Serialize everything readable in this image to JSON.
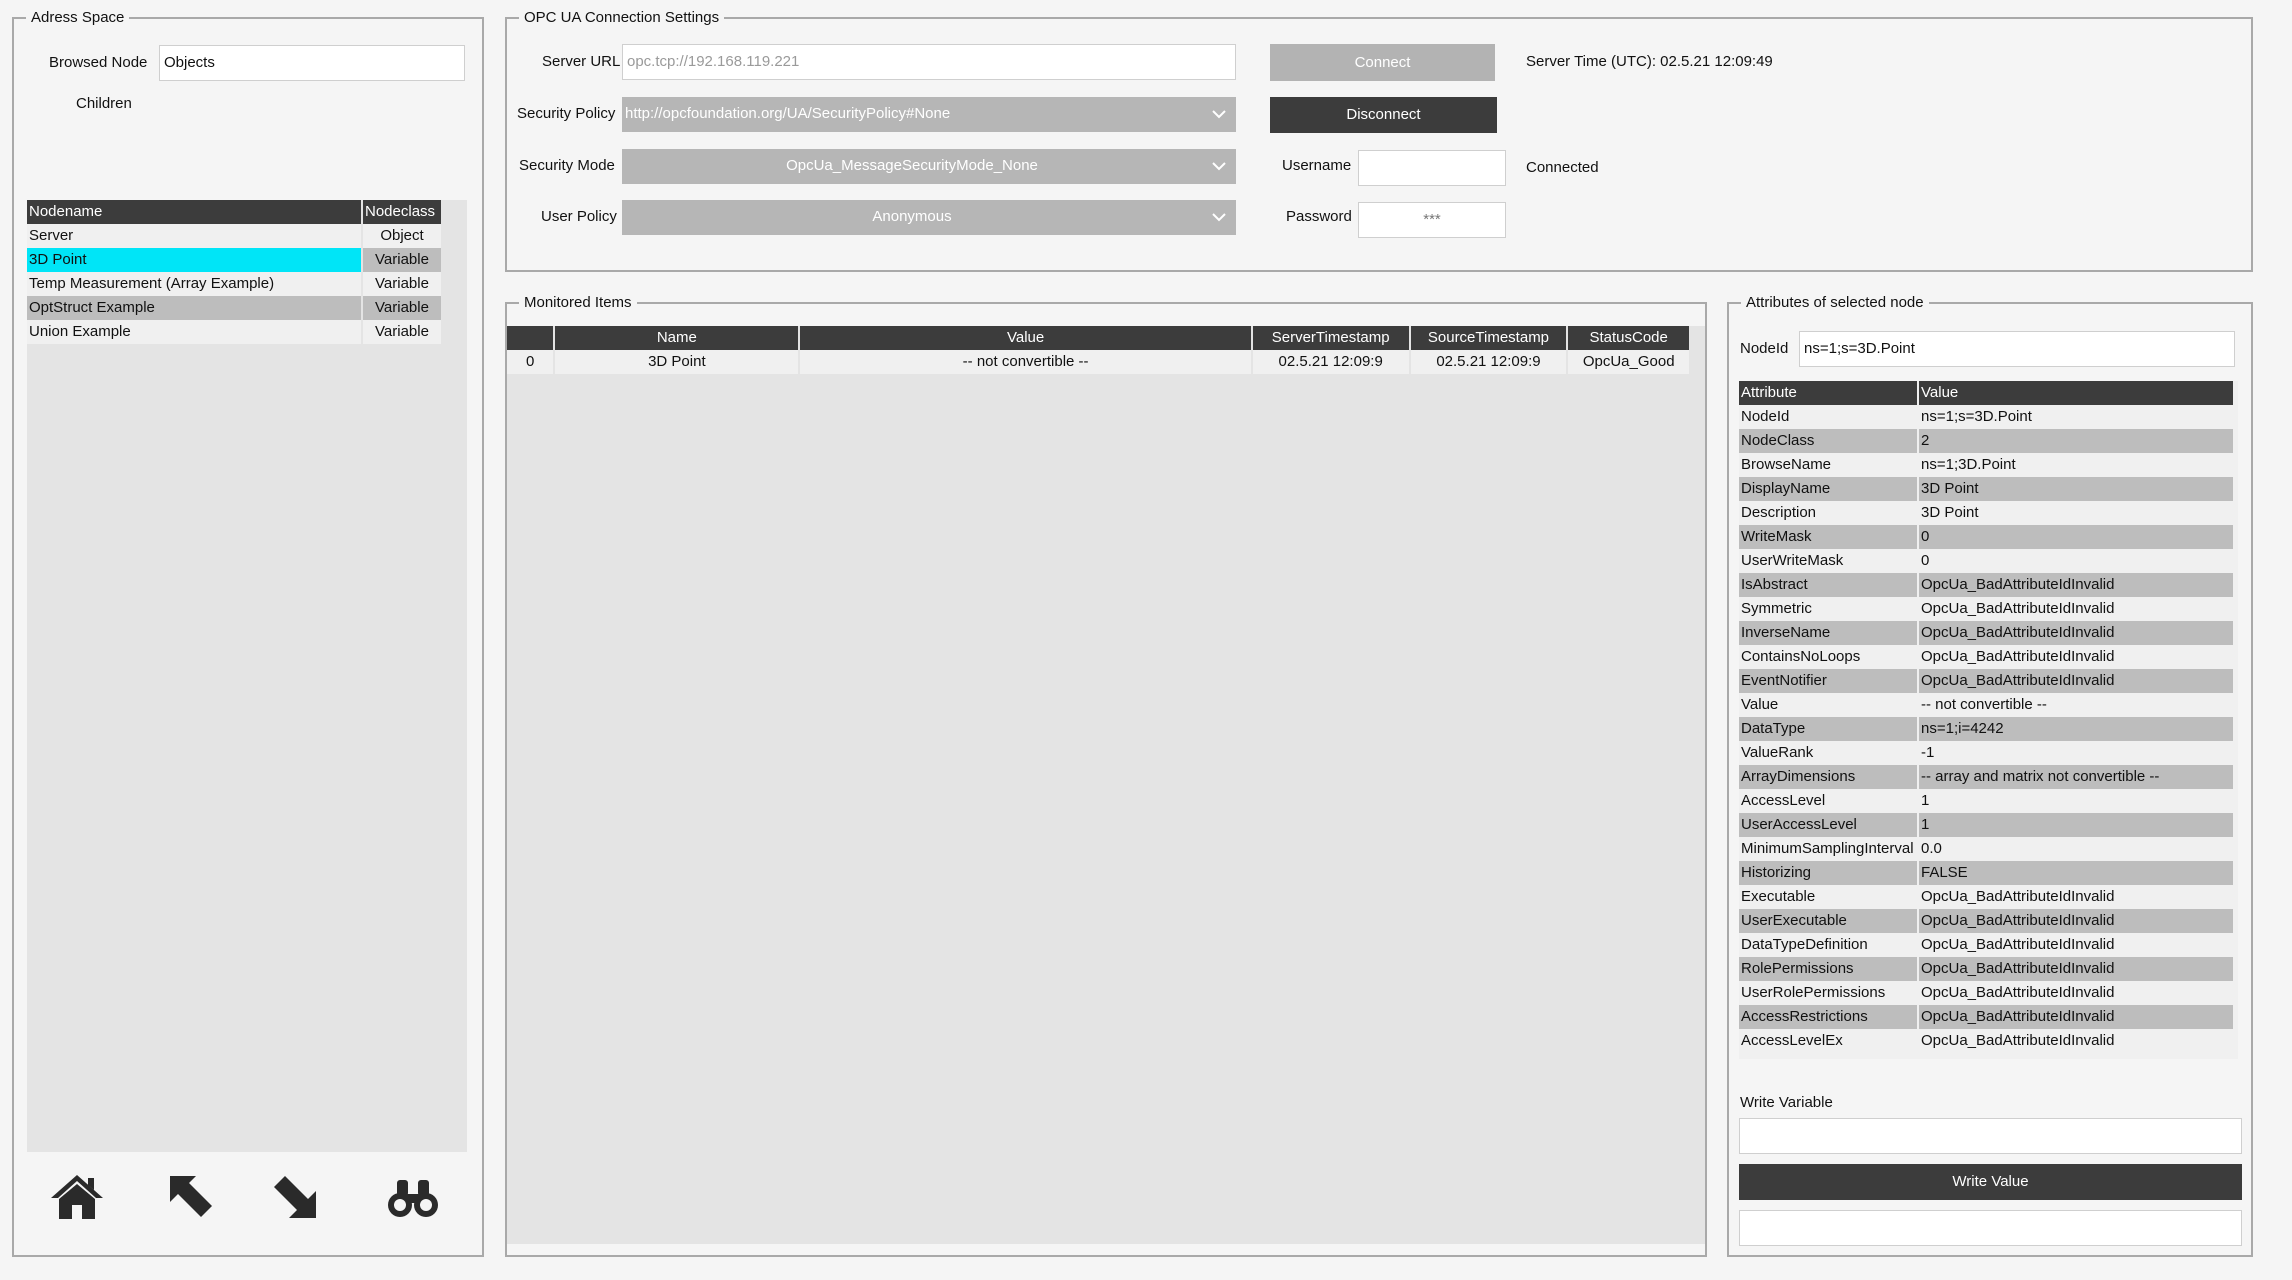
{
  "address_space": {
    "title": "Adress Space",
    "browsed_node_label": "Browsed Node",
    "browsed_node_value": "Objects",
    "children_label": "Children",
    "columns": [
      "Nodename",
      "Nodeclass"
    ],
    "rows": [
      {
        "name": "Server",
        "cls": "Object"
      },
      {
        "name": "3D Point",
        "cls": "Variable"
      },
      {
        "name": "Temp Measurement (Array Example)",
        "cls": "Variable"
      },
      {
        "name": "OptStruct Example",
        "cls": "Variable"
      },
      {
        "name": "Union Example",
        "cls": "Variable"
      }
    ],
    "selected_row": 1,
    "nav_icons": [
      "home-icon",
      "arrow-up-left-icon",
      "arrow-down-right-icon",
      "binoculars-icon"
    ]
  },
  "connection": {
    "title": "OPC UA Connection Settings",
    "server_url_label": "Server URL",
    "server_url_placeholder": "opc.tcp://192.168.119.221",
    "security_policy_label": "Security Policy",
    "security_policy_value": "http://opcfoundation.org/UA/SecurityPolicy#None",
    "security_mode_label": "Security Mode",
    "security_mode_value": "OpcUa_MessageSecurityMode_None",
    "user_policy_label": "User Policy",
    "user_policy_value": "Anonymous",
    "connect_label": "Connect",
    "disconnect_label": "Disconnect",
    "username_label": "Username",
    "username_value": "",
    "password_label": "Password",
    "password_value": "***",
    "server_time": "Server Time (UTC): 02.5.21 12:09:49",
    "status": "Connected"
  },
  "monitored": {
    "title": "Monitored Items",
    "columns": [
      "",
      "Name",
      "Value",
      "ServerTimestamp",
      "SourceTimestamp",
      "StatusCode"
    ],
    "rows": [
      [
        "0",
        "3D Point",
        "-- not convertible --",
        "02.5.21 12:09:9",
        "02.5.21 12:09:9",
        "OpcUa_Good"
      ]
    ]
  },
  "attributes": {
    "title": "Attributes of selected node",
    "nodeid_label": "NodeId",
    "nodeid_value": "ns=1;s=3D.Point",
    "columns": [
      "Attribute",
      "Value"
    ],
    "rows": [
      [
        "NodeId",
        "ns=1;s=3D.Point"
      ],
      [
        "NodeClass",
        "2"
      ],
      [
        "BrowseName",
        "ns=1;3D.Point"
      ],
      [
        "DisplayName",
        "3D Point"
      ],
      [
        "Description",
        "3D Point"
      ],
      [
        "WriteMask",
        "0"
      ],
      [
        "UserWriteMask",
        "0"
      ],
      [
        "IsAbstract",
        "OpcUa_BadAttributeIdInvalid"
      ],
      [
        "Symmetric",
        "OpcUa_BadAttributeIdInvalid"
      ],
      [
        "InverseName",
        "OpcUa_BadAttributeIdInvalid"
      ],
      [
        "ContainsNoLoops",
        "OpcUa_BadAttributeIdInvalid"
      ],
      [
        "EventNotifier",
        "OpcUa_BadAttributeIdInvalid"
      ],
      [
        "Value",
        "-- not convertible --"
      ],
      [
        "DataType",
        "ns=1;i=4242"
      ],
      [
        "ValueRank",
        "-1"
      ],
      [
        "ArrayDimensions",
        " -- array and matrix not convertible --"
      ],
      [
        "AccessLevel",
        "1"
      ],
      [
        "UserAccessLevel",
        "1"
      ],
      [
        "MinimumSamplingInterval",
        "0.0"
      ],
      [
        "Historizing",
        "FALSE"
      ],
      [
        "Executable",
        "OpcUa_BadAttributeIdInvalid"
      ],
      [
        "UserExecutable",
        "OpcUa_BadAttributeIdInvalid"
      ],
      [
        "DataTypeDefinition",
        "OpcUa_BadAttributeIdInvalid"
      ],
      [
        "RolePermissions",
        "OpcUa_BadAttributeIdInvalid"
      ],
      [
        "UserRolePermissions",
        "OpcUa_BadAttributeIdInvalid"
      ],
      [
        "AccessRestrictions",
        "OpcUa_BadAttributeIdInvalid"
      ],
      [
        "AccessLevelEx",
        "OpcUa_BadAttributeIdInvalid"
      ]
    ],
    "write_variable_label": "Write Variable",
    "write_variable_value": "",
    "write_button_label": "Write Value",
    "write_result_value": ""
  },
  "colors": {
    "header": "#3c3c3c",
    "selection": "#00e5f7",
    "row_alt": "#bdbdbd",
    "button_light": "#b3b3b3",
    "button_dark": "#3c3c3c"
  }
}
